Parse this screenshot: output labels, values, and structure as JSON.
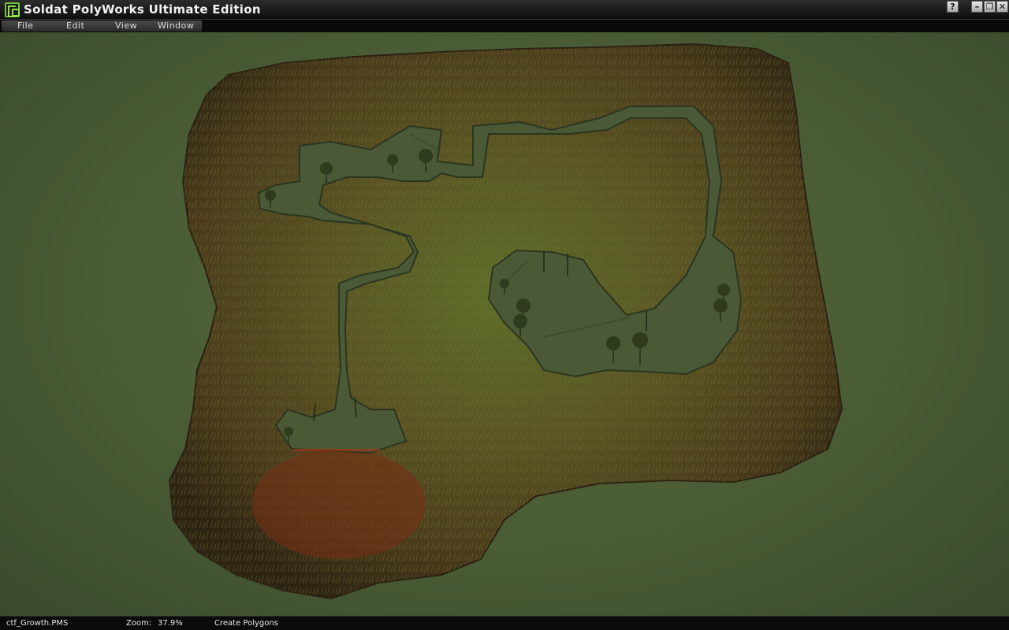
{
  "window": {
    "title": "Soldat PolyWorks Ultimate Edition",
    "help_label": "?",
    "minimize_label": "–",
    "restore_label": "❐",
    "close_label": "✕"
  },
  "menu": {
    "items": [
      {
        "label": "File"
      },
      {
        "label": "Edit"
      },
      {
        "label": "View"
      },
      {
        "label": "Window"
      }
    ]
  },
  "status": {
    "filename": "ctf_Growth.PMS",
    "zoom_label": "Zoom:",
    "zoom_value": "37.9%",
    "tool": "Create Polygons"
  },
  "colors": {
    "viewport_bg": "#4a5c35",
    "terrain_brown": "#5b4a22",
    "terrain_green": "#4e6a25",
    "lava_red": "#8a2a14"
  },
  "icons": {
    "app": "polyworks-logo-icon"
  }
}
